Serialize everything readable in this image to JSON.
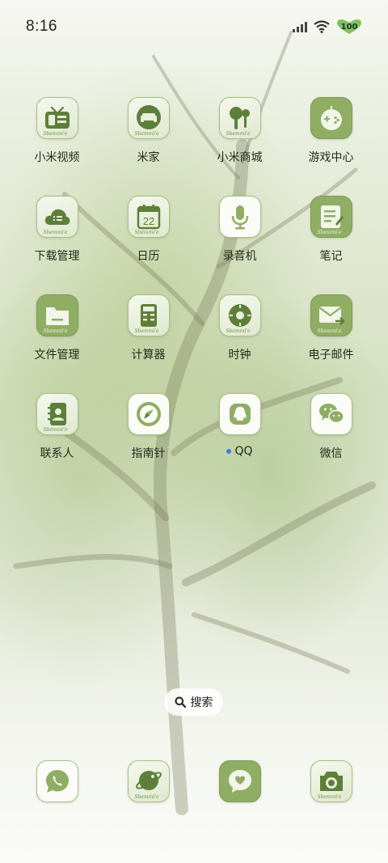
{
  "status_bar": {
    "time": "8:16",
    "battery": "100"
  },
  "apps": [
    {
      "label": "小米视频",
      "icon": "tv-icon",
      "style": "light"
    },
    {
      "label": "米家",
      "icon": "sofa-icon",
      "style": "light"
    },
    {
      "label": "小米商城",
      "icon": "shopping-bag-icon",
      "style": "light"
    },
    {
      "label": "游戏中心",
      "icon": "gamepad-icon",
      "style": "solid"
    },
    {
      "label": "下载管理",
      "icon": "cloud-download-icon",
      "style": "light"
    },
    {
      "label": "日历",
      "icon": "calendar-icon",
      "style": "light",
      "date": "22"
    },
    {
      "label": "录音机",
      "icon": "microphone-icon",
      "style": "white"
    },
    {
      "label": "笔记",
      "icon": "notes-icon",
      "style": "solid"
    },
    {
      "label": "文件管理",
      "icon": "folder-icon",
      "style": "solid"
    },
    {
      "label": "计算器",
      "icon": "calculator-icon",
      "style": "light"
    },
    {
      "label": "时钟",
      "icon": "clock-icon",
      "style": "light"
    },
    {
      "label": "电子邮件",
      "icon": "mail-icon",
      "style": "solid"
    },
    {
      "label": "联系人",
      "icon": "contacts-icon",
      "style": "light"
    },
    {
      "label": "指南针",
      "icon": "compass-icon",
      "style": "white"
    },
    {
      "label": "QQ",
      "icon": "qq-icon",
      "style": "white",
      "badge_dot": true
    },
    {
      "label": "微信",
      "icon": "wechat-icon",
      "style": "white"
    }
  ],
  "search": {
    "label": "搜索"
  },
  "dock": [
    {
      "icon": "phone-icon",
      "style": "white"
    },
    {
      "icon": "browser-icon",
      "style": "light"
    },
    {
      "icon": "message-icon",
      "style": "solid"
    },
    {
      "icon": "camera-icon",
      "style": "light"
    }
  ],
  "colors": {
    "accent_green": "#8fae63",
    "dark_green": "#5e7f3a",
    "notification_dot": "#3b7bf0"
  }
}
